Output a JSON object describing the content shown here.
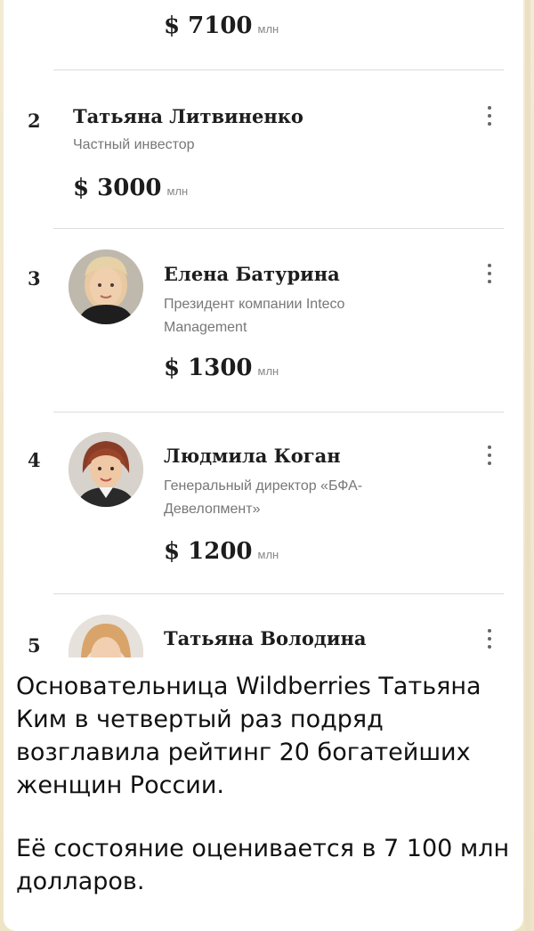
{
  "ranking": {
    "top_amount": {
      "value": "$ 7100",
      "unit": "млн"
    },
    "entries": [
      {
        "rank": "2",
        "name": "Татьяна Литвиненко",
        "role": "Частный инвестор",
        "amount": "$ 3000",
        "unit": "млн",
        "avatar": ""
      },
      {
        "rank": "3",
        "name": "Елена Батурина",
        "role": "Президент компании Inteco Management",
        "amount": "$ 1300",
        "unit": "млн",
        "avatar": "photo"
      },
      {
        "rank": "4",
        "name": "Людмила Коган",
        "role": "Генеральный директор «БФА-Девелопмент»",
        "amount": "$ 1200",
        "unit": "млн",
        "avatar": "photo"
      },
      {
        "rank": "5",
        "name": "Татьяна Володина",
        "role": "",
        "amount": "",
        "unit": "",
        "avatar": "photo"
      }
    ],
    "menu_icon": "more-vertical-icon"
  },
  "message": {
    "paragraph1": "Основательница Wildberries Татьяна Ким в четвертый раз подряд возглавила рейтинг 20 богатейших женщин России.",
    "paragraph2": "Её состояние оценивается в 7 100 млн долларов."
  },
  "colors": {
    "background": "#f2ead3",
    "bubble": "#ffffff",
    "text": "#111111",
    "muted": "#777777"
  }
}
